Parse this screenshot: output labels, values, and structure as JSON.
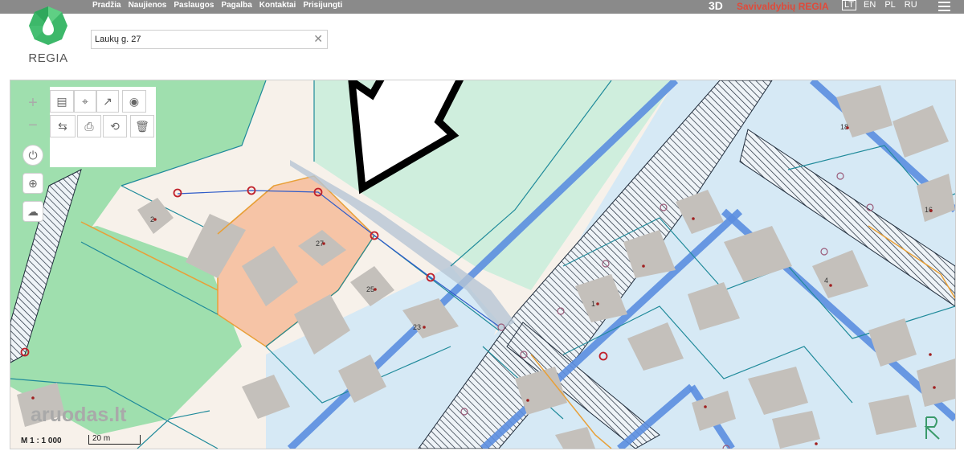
{
  "nav": {
    "items": [
      "Pradžia",
      "Naujienos",
      "Paslaugos",
      "Pagalba",
      "Kontaktai",
      "Prisijungti"
    ]
  },
  "header": {
    "btn_3d": "3D",
    "brand": "Savivaldybių REGIA",
    "langs": [
      "LT",
      "EN",
      "PL",
      "RU"
    ],
    "active_lang": "LT"
  },
  "logo": {
    "text": "REGIA"
  },
  "search": {
    "value": "Laukų g. 27"
  },
  "map": {
    "house_numbers": [
      "2",
      "27",
      "25",
      "23",
      "1",
      "4",
      "16",
      "18"
    ],
    "scale": "M 1 : 1 000",
    "scale_bar": "20 m",
    "watermark": "aruodas.lt",
    "colors": {
      "road_blue": "#5c8fe0",
      "parcel_blue": "#d6e9f5",
      "green": "#9fdfae",
      "highlight": "#f6c4a6",
      "base": "#f7f1ea",
      "building": "#c4c0bb"
    }
  },
  "tools": [
    "zoom-in",
    "zoom-out",
    "measure",
    "place-marker",
    "export",
    "locate",
    "move",
    "print",
    "reset",
    "delete",
    "time",
    "gps",
    "draw-area"
  ]
}
